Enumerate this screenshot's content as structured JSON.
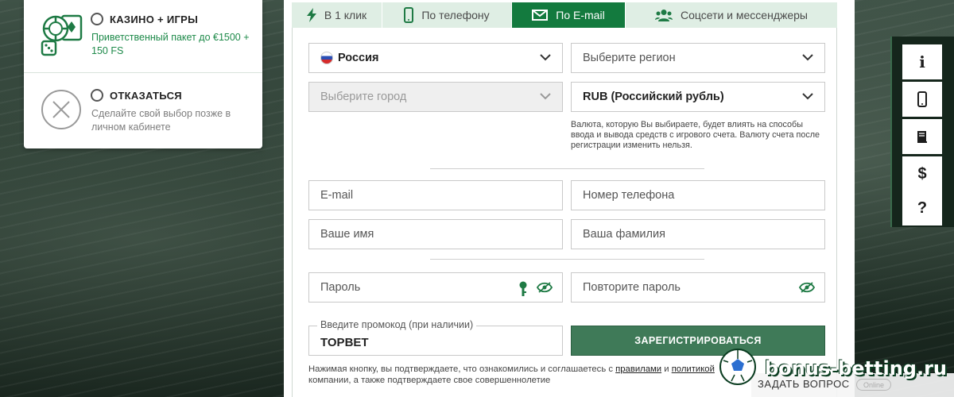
{
  "bonus": {
    "options": [
      {
        "title": "КАЗИНО + ИГРЫ",
        "desc": "Приветственный пакет до €1500 + 150 FS",
        "icon": "casino-chips-icon"
      },
      {
        "title": "ОТКАЗАТЬСЯ",
        "desc": "Сделайте свой выбор позже в личном кабинете",
        "icon": "close-circle-icon"
      }
    ]
  },
  "tabs": [
    {
      "label": "В 1 клик",
      "icon": "lightning-icon",
      "active": false
    },
    {
      "label": "По телефону",
      "icon": "phone-icon",
      "active": false
    },
    {
      "label": "По E-mail",
      "icon": "envelope-icon",
      "active": true
    },
    {
      "label": "Соцсети и мессенджеры",
      "icon": "users-icon",
      "active": false
    }
  ],
  "form": {
    "country": "Россия",
    "region_placeholder": "Выберите регион",
    "city_placeholder": "Выберите город",
    "currency": "RUB (Российский рубль)",
    "currency_note": "Валюта, которую Вы выбираете, будет влиять на способы ввода и вывода средств с игрового счета. Валюту счета после регистрации изменить нельзя.",
    "email_placeholder": "E-mail",
    "phone_placeholder": "Номер телефона",
    "name_placeholder": "Ваше имя",
    "surname_placeholder": "Ваша фамилия",
    "password_placeholder": "Пароль",
    "password_repeat_placeholder": "Повторите пароль",
    "promo_label": "Введите промокод (при наличии)",
    "promo_value": "TOPBET",
    "register_label": "ЗАРЕГИСТРИРОВАТЬСЯ",
    "terms_prefix": "Нажимая кнопку, вы подтверждаете, что ознакомились и соглашаетесь с",
    "terms_link1": "правилами",
    "terms_and": "и",
    "terms_link2": "политикой",
    "terms_suffix": "компании, а также подтверждаете свое совершеннолетие"
  },
  "sidebar": {
    "items": [
      {
        "icon": "info-icon",
        "glyph": "i"
      },
      {
        "icon": "mobile-icon",
        "glyph": ""
      },
      {
        "icon": "book-icon",
        "glyph": ""
      },
      {
        "icon": "dollar-icon",
        "glyph": "$"
      },
      {
        "icon": "question-icon",
        "glyph": "?"
      }
    ]
  },
  "footer": {
    "ask_label": "ЗАДАТЬ ВОПРОС",
    "ask_badge": "Online"
  },
  "watermark": {
    "text": "bonus-betting.ru"
  },
  "colors": {
    "accent": "#137a3e",
    "tab_bg": "#dfeee4",
    "button": "#3f7a58",
    "bonus_text": "#1e8a4a"
  }
}
